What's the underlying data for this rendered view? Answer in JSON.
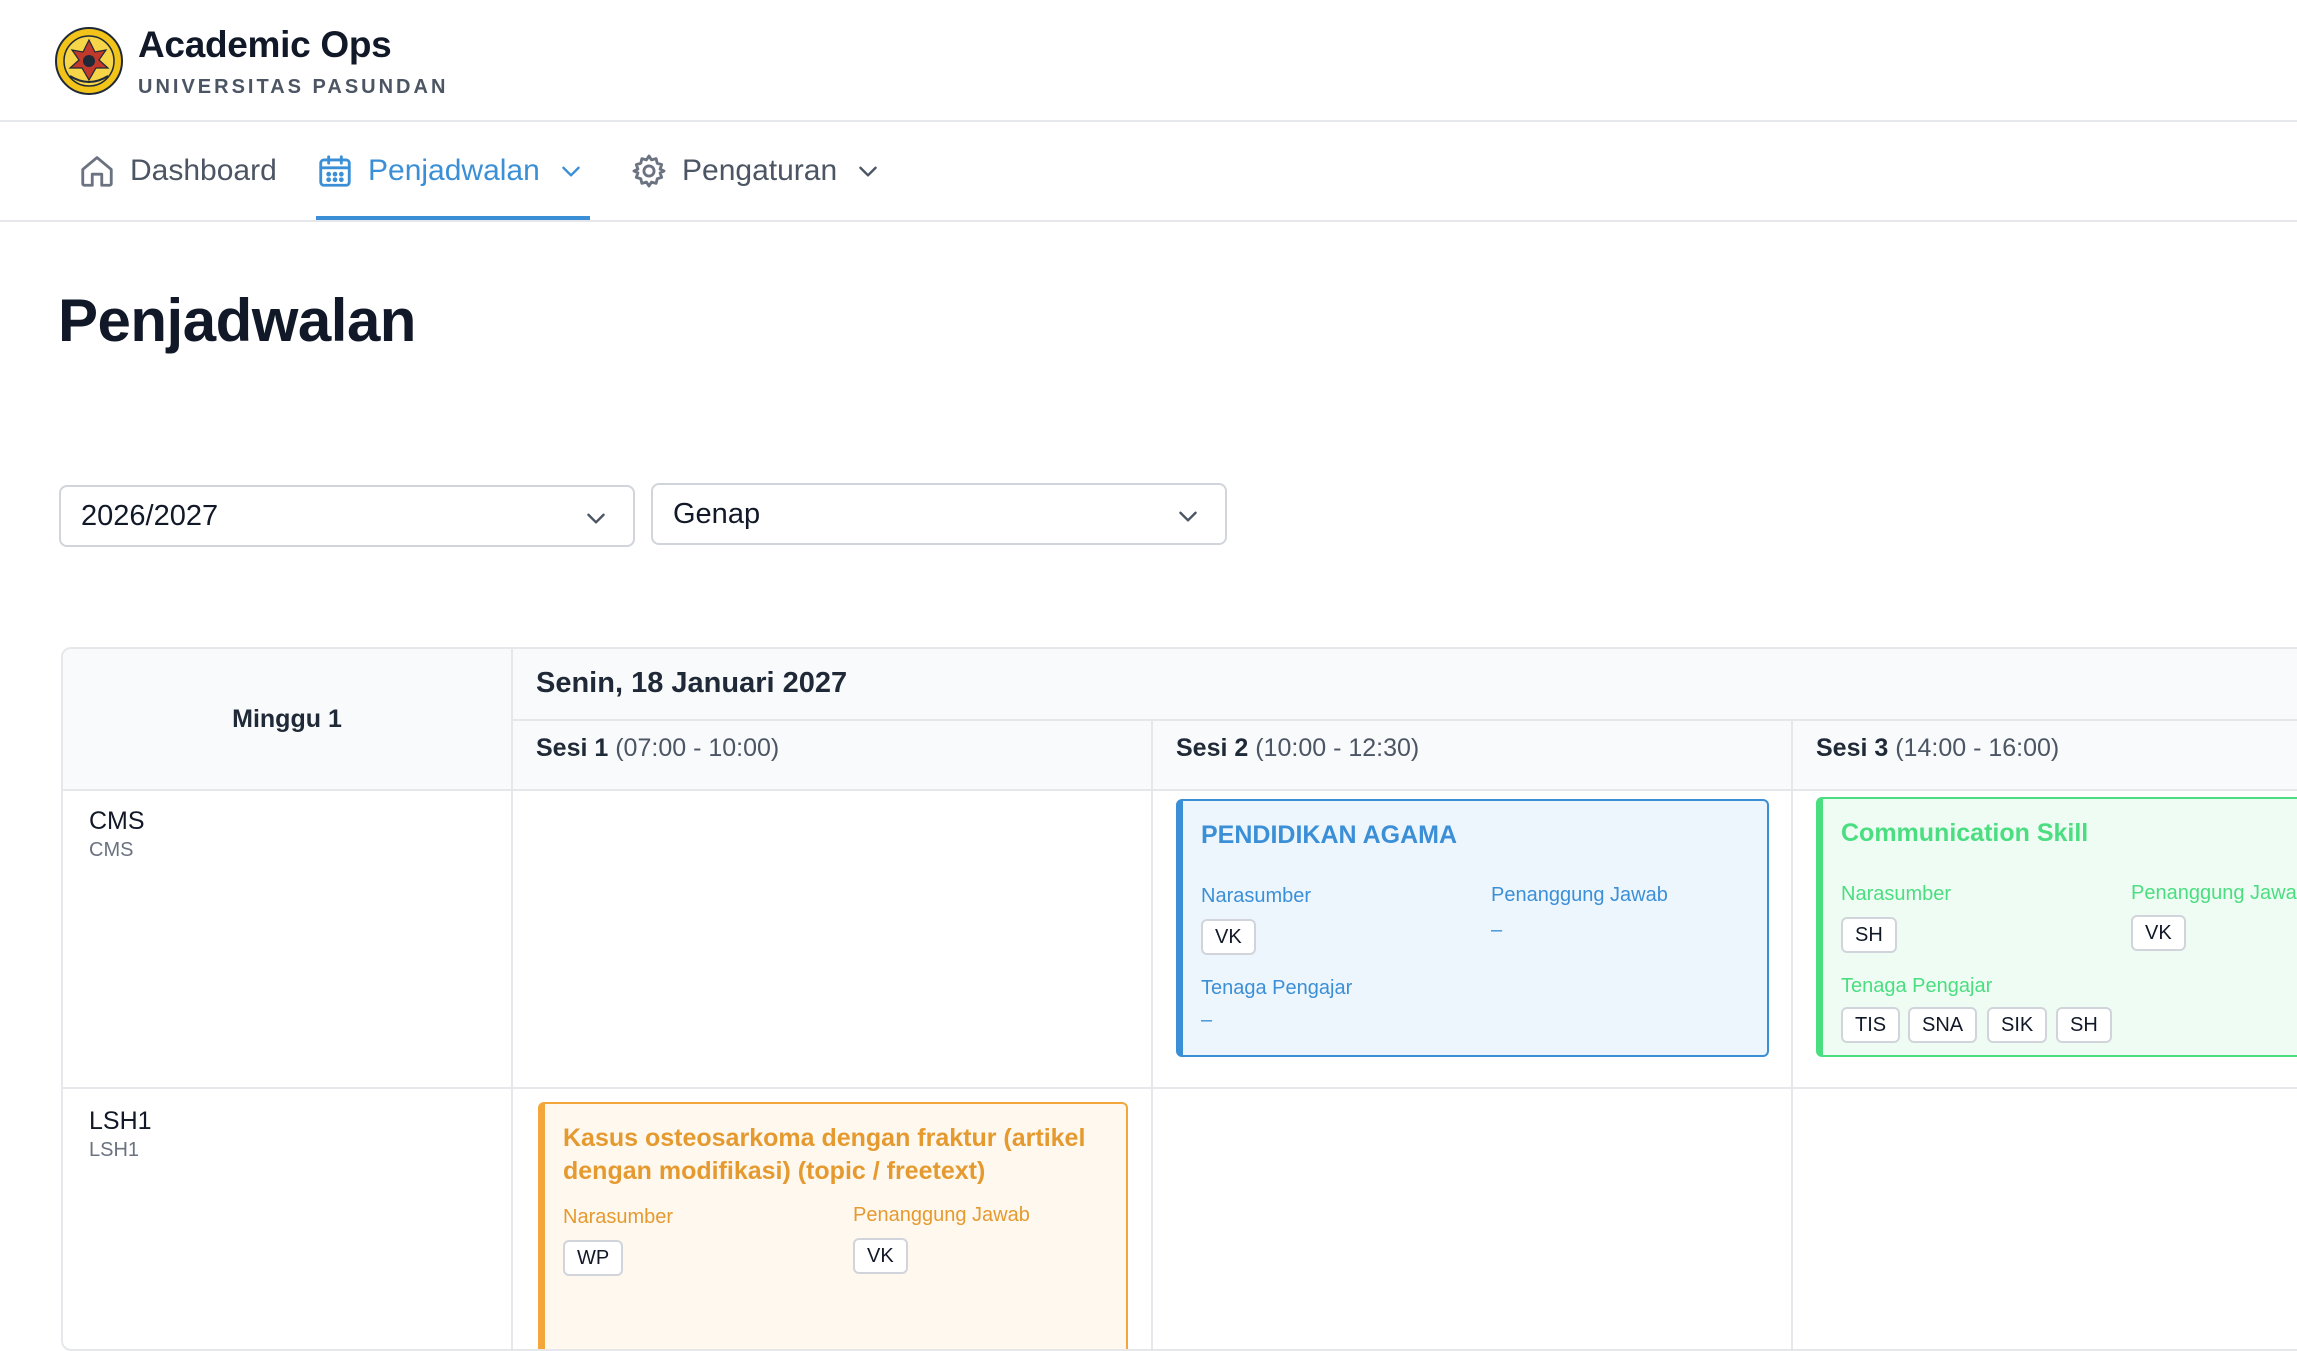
{
  "app": {
    "title": "Academic Ops",
    "subtitle": "UNIVERSITAS PASUNDAN",
    "logo_icon": "university-seal"
  },
  "nav": {
    "items": [
      {
        "label": "Dashboard",
        "icon": "home-icon"
      },
      {
        "label": "Penjadwalan",
        "icon": "calendar-icon",
        "active": true
      },
      {
        "label": "Pengaturan",
        "icon": "gear-icon"
      }
    ]
  },
  "page": {
    "title": "Penjadwalan"
  },
  "filters": {
    "year": {
      "value": "2026/2027"
    },
    "semester": {
      "value": "Genap"
    }
  },
  "schedule": {
    "week_label": "Minggu 1",
    "day_label": "Senin, 18 Januari 2027",
    "sessions": [
      {
        "name": "Sesi 1",
        "time": "(07:00 - 10:00)"
      },
      {
        "name": "Sesi 2",
        "time": "(10:00 - 12:30)"
      },
      {
        "name": "Sesi 3",
        "time": "(14:00 - 16:00)"
      }
    ],
    "rows": [
      {
        "name": "CMS",
        "code": "CMS"
      },
      {
        "name": "LSH1",
        "code": "LSH1"
      }
    ],
    "labels": {
      "narasumber": "Narasumber",
      "penanggung_jawab": "Penanggung Jawab",
      "tenaga_pengajar": "Tenaga Pengajar",
      "empty": "–"
    },
    "cards": [
      {
        "title": "PENDIDIKAN AGAMA",
        "narasumber": [
          "VK"
        ],
        "penanggung_jawab": [],
        "tenaga_pengajar": []
      },
      {
        "title": "Communication Skill",
        "narasumber": [
          "SH"
        ],
        "penanggung_jawab": [
          "VK"
        ],
        "tenaga_pengajar": [
          "TIS",
          "SNA",
          "SIK",
          "SH"
        ]
      },
      {
        "title": "Kasus osteosarkoma dengan fraktur (artikel dengan modifikasi) (topic / freetext)",
        "narasumber": [
          "WP"
        ],
        "penanggung_jawab": [
          "VK"
        ]
      }
    ]
  },
  "colors": {
    "accent": "#3b8fd6",
    "card_blue": "#3b8fd6",
    "card_green": "#4ade80",
    "card_orange": "#f3a73b"
  }
}
